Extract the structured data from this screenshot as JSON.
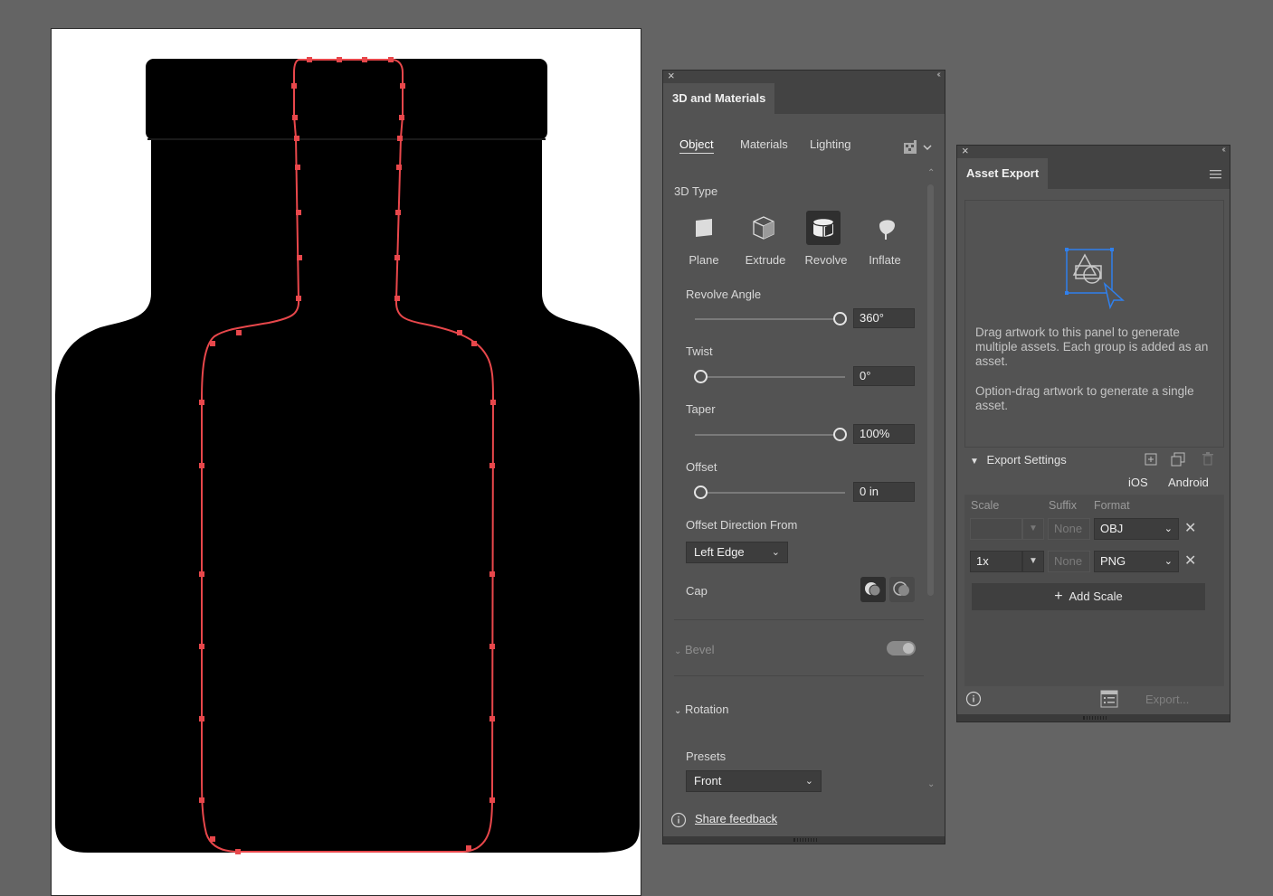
{
  "panel3d": {
    "title": "3D and Materials",
    "subtabs": [
      "Object",
      "Materials",
      "Lighting"
    ],
    "section_3d_type": "3D Type",
    "types": [
      {
        "label": "Plane",
        "icon": "plane-icon",
        "active": false
      },
      {
        "label": "Extrude",
        "icon": "extrude-icon",
        "active": false
      },
      {
        "label": "Revolve",
        "icon": "revolve-icon",
        "active": true
      },
      {
        "label": "Inflate",
        "icon": "inflate-icon",
        "active": false
      }
    ],
    "revolve_angle": {
      "label": "Revolve Angle",
      "value": "360°",
      "fraction": 1.0
    },
    "twist": {
      "label": "Twist",
      "value": "0°",
      "fraction": 0.0
    },
    "taper": {
      "label": "Taper",
      "value": "100%",
      "fraction": 1.0
    },
    "offset": {
      "label": "Offset",
      "value": "0 in",
      "fraction": 0.0
    },
    "offset_direction": {
      "label": "Offset Direction From",
      "value": "Left Edge"
    },
    "cap": {
      "label": "Cap"
    },
    "bevel": {
      "label": "Bevel"
    },
    "rotation": {
      "label": "Rotation"
    },
    "presets": {
      "label": "Presets",
      "value": "Front"
    },
    "share_feedback": "Share feedback"
  },
  "asset_export": {
    "title": "Asset Export",
    "drop_text_1": "Drag artwork to this panel to generate multiple assets. Each group is added as an asset.",
    "drop_text_2": "Option-drag artwork to generate a single asset.",
    "export_settings": "Export Settings",
    "platforms": [
      "iOS",
      "Android"
    ],
    "columns": {
      "scale": "Scale",
      "suffix": "Suffix",
      "format": "Format"
    },
    "rows": [
      {
        "scale": "",
        "suffix": "None",
        "format": "OBJ"
      },
      {
        "scale": "1x",
        "suffix": "None",
        "format": "PNG"
      }
    ],
    "add_scale": "Add Scale",
    "export_button": "Export..."
  },
  "colors": {
    "app_bg": "#646464",
    "panel_bg": "#535353",
    "path_highlight": "#e8474b",
    "accent_blue": "#2f80ed"
  }
}
